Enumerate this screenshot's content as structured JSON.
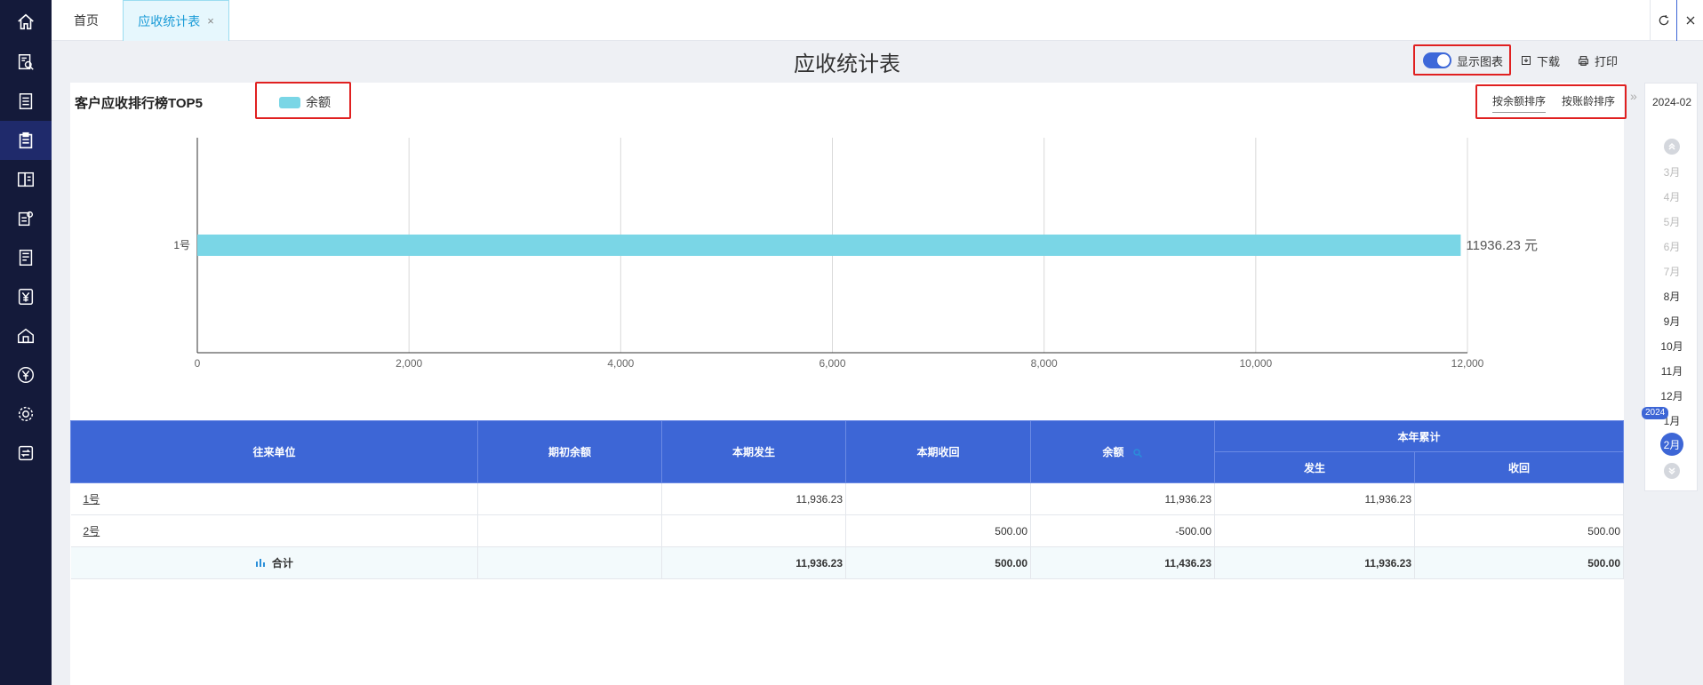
{
  "tabs": {
    "home": "首页",
    "active": "应收统计表",
    "close": "×"
  },
  "page": {
    "title": "应收统计表"
  },
  "toolbar": {
    "show_chart": "显示图表",
    "show_chart_on": true,
    "download": "下载",
    "print": "打印"
  },
  "chart": {
    "title": "客户应收排行榜TOP5",
    "legend": "余额",
    "sort_by_amount": "按余额排序",
    "sort_by_age": "按账龄排序"
  },
  "chart_data": {
    "type": "bar",
    "orientation": "horizontal",
    "categories": [
      "1号"
    ],
    "series": [
      {
        "name": "余额",
        "values": [
          11936.23
        ],
        "color": "#7ad6e6"
      }
    ],
    "value_labels": [
      "11936.23 元"
    ],
    "xticks": [
      "0",
      "2,000",
      "4,000",
      "6,000",
      "8,000",
      "10,000",
      "12,000"
    ],
    "xlim": [
      0,
      12000
    ],
    "grid": "vertical",
    "legend_position": "top-left"
  },
  "table": {
    "headers": {
      "unit": "往来单位",
      "opening": "期初余额",
      "period_occur": "本期发生",
      "period_recv": "本期收回",
      "balance": "余额",
      "year_total": "本年累计",
      "year_occur": "发生",
      "year_recv": "收回"
    },
    "rows": [
      {
        "unit": "1号",
        "opening": "",
        "period_occur": "11,936.23",
        "period_recv": "",
        "balance": "11,936.23",
        "year_occur": "11,936.23",
        "year_recv": ""
      },
      {
        "unit": "2号",
        "opening": "",
        "period_occur": "",
        "period_recv": "500.00",
        "balance": "-500.00",
        "year_occur": "",
        "year_recv": "500.00"
      }
    ],
    "total": {
      "unit": "合计",
      "opening": "",
      "period_occur": "11,936.23",
      "period_recv": "500.00",
      "balance": "11,436.23",
      "year_occur": "11,936.23",
      "year_recv": "500.00"
    }
  },
  "month_panel": {
    "current": "2024-02",
    "months": [
      "3月",
      "4月",
      "5月",
      "6月",
      "7月",
      "8月",
      "9月",
      "10月",
      "11月",
      "12月",
      "1月"
    ],
    "year_badge": "2024",
    "selected": "2月"
  },
  "colors": {
    "nav_bg": "#141a3a",
    "accent": "#3d66d6",
    "bar": "#7ad6e6",
    "highlight_box": "#e02020"
  }
}
